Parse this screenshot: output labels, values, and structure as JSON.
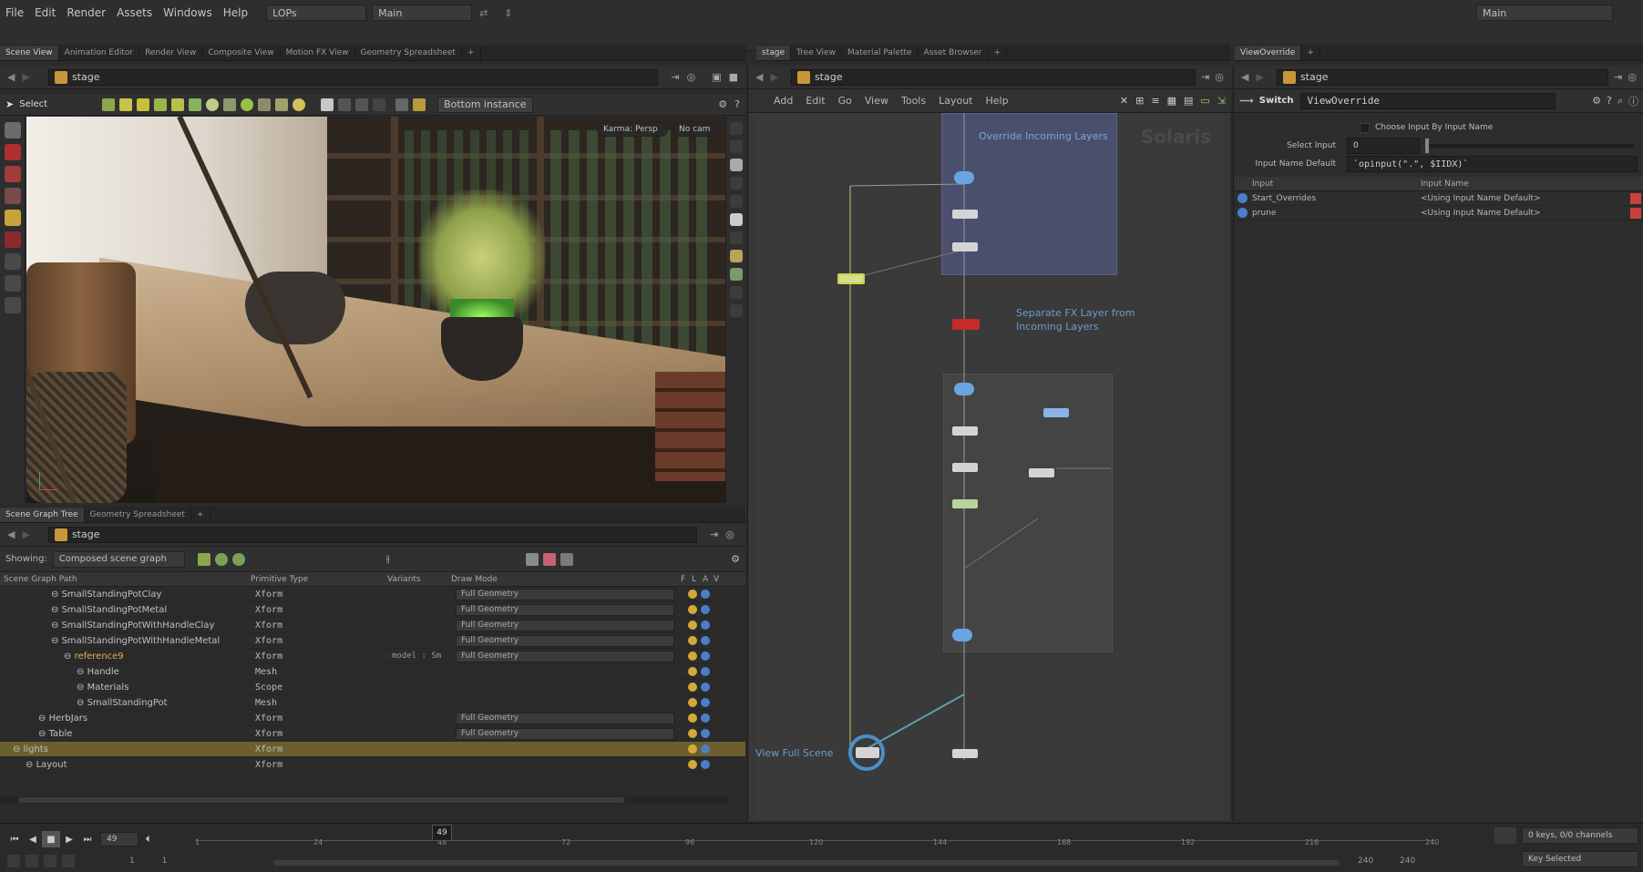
{
  "menubar": {
    "items": [
      "File",
      "Edit",
      "Render",
      "Assets",
      "Windows",
      "Help"
    ],
    "context": "LOPs",
    "desktop": "Main",
    "right_desktop": "Main"
  },
  "left_tabs": [
    "Scene View",
    "Animation Editor",
    "Render View",
    "Composite View",
    "Motion FX View",
    "Geometry Spreadsheet"
  ],
  "middle_tabs": [
    "stage",
    "Tree View",
    "Material Palette",
    "Asset Browser"
  ],
  "right_tabs": [
    "ViewOverride"
  ],
  "viewport": {
    "path": "stage",
    "select_label": "Select",
    "instance_dropdown": "Bottom instance",
    "renderer": "Karma: Persp",
    "camera": "No cam"
  },
  "scene_graph": {
    "tabs": [
      "Scene Graph Tree",
      "Geometry Spreadsheet"
    ],
    "path": "stage",
    "showing_label": "Showing:",
    "showing_value": "Composed scene graph",
    "columns": [
      "Scene Graph Path",
      "Primitive Type",
      "Variants",
      "Draw Mode",
      "F",
      "L",
      "A",
      "V"
    ],
    "rows": [
      {
        "indent": 4,
        "name": "SmallStandingPotClay",
        "type": "Xform",
        "variants": "",
        "draw": "Full Geometry"
      },
      {
        "indent": 4,
        "name": "SmallStandingPotMetal",
        "type": "Xform",
        "variants": "",
        "draw": "Full Geometry"
      },
      {
        "indent": 4,
        "name": "SmallStandingPotWithHandleClay",
        "type": "Xform",
        "variants": "",
        "draw": "Full Geometry"
      },
      {
        "indent": 4,
        "name": "SmallStandingPotWithHandleMetal",
        "type": "Xform",
        "variants": "",
        "draw": "Full Geometry"
      },
      {
        "indent": 5,
        "name": "reference9",
        "type": "Xform",
        "variants": "model : Sm",
        "draw": "Full Geometry",
        "highlight": true
      },
      {
        "indent": 6,
        "name": "Handle",
        "type": "Mesh",
        "variants": "",
        "draw": ""
      },
      {
        "indent": 6,
        "name": "Materials",
        "type": "Scope",
        "variants": "",
        "draw": ""
      },
      {
        "indent": 6,
        "name": "SmallStandingPot",
        "type": "Mesh",
        "variants": "",
        "draw": ""
      },
      {
        "indent": 3,
        "name": "HerbJars",
        "type": "Xform",
        "variants": "",
        "draw": "Full Geometry"
      },
      {
        "indent": 3,
        "name": "Table",
        "type": "Xform",
        "variants": "",
        "draw": "Full Geometry"
      },
      {
        "indent": 1,
        "name": "lights",
        "type": "Xform",
        "variants": "",
        "draw": "",
        "selected": true
      },
      {
        "indent": 2,
        "name": "Layout",
        "type": "Xform",
        "variants": "",
        "draw": ""
      }
    ]
  },
  "network": {
    "path": "stage",
    "menu": [
      "Add",
      "Edit",
      "Go",
      "View",
      "Tools",
      "Layout",
      "Help"
    ],
    "watermark": "Solaris",
    "box1_title": "Override Incoming Layers",
    "sticky_note": "Separate FX Layer from Incoming Layers",
    "view_full_scene": "View Full Scene"
  },
  "params": {
    "path": "stage",
    "node_type": "Switch",
    "node_name": "ViewOverride",
    "choose_label": "Choose Input By Input Name",
    "select_input_label": "Select Input",
    "select_input_value": "0",
    "input_name_default_label": "Input Name Default",
    "input_name_default_value": "`opinput(\".\", $IIDX)`",
    "table_headers": [
      "Input",
      "Input Name"
    ],
    "inputs": [
      {
        "name": "Start_Overrides",
        "value": "<Using Input Name Default>"
      },
      {
        "name": "prune",
        "value": "<Using Input Name Default>"
      }
    ]
  },
  "timeline": {
    "frame": "49",
    "current": "49",
    "ticks": [
      "1",
      "24",
      "48",
      "72",
      "96",
      "120",
      "144",
      "168",
      "192",
      "216",
      "240"
    ],
    "start": "1",
    "start2": "1",
    "end": "240",
    "end2": "240",
    "keys": "0 keys, 0/0 channels",
    "key_selected": "Key Selected"
  }
}
